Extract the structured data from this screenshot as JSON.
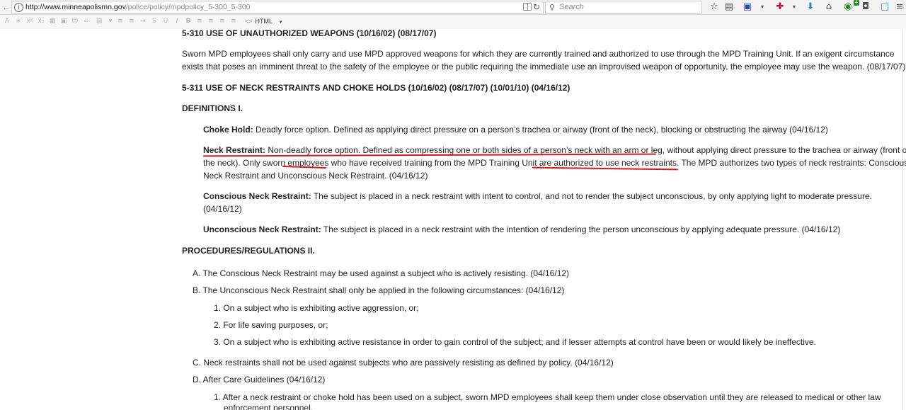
{
  "browser": {
    "url_host": "http://www.minneapolismn.gov",
    "url_path": "/police/policy/mpdpolicy_5-300_5-300",
    "search_placeholder": "Search",
    "badge_count": "4",
    "html_mode": "HTML"
  },
  "doc": {
    "s310_heading": "5-310 USE OF UNAUTHORIZED WEAPONS (10/16/02) (08/17/07)",
    "s310_p1": "Sworn MPD employees shall only carry and use MPD approved weapons for which they are currently trained and authorized to use through the MPD Training Unit. If an exigent circumstance",
    "s310_p2": "exists that poses an imminent threat to the safety of the employee or the public requiring the immediate use an improvised weapon of opportunity, the employee may use the weapon. (08/17/07)",
    "s311_heading": "5-311 USE OF NECK RESTRAINTS AND CHOKE HOLDS (10/16/02) (08/17/07) (10/01/10) (04/16/12)",
    "definitions_heading": "DEFINITIONS I.",
    "choke_term": "Choke Hold:",
    "choke_def": " Deadly force option. Defined as applying direct pressure on a person’s trachea or airway (front of the neck), blocking or obstructing the airway (04/16/12)",
    "neck_term": "Neck Restraint:",
    "neck_l1": " Non-deadly force option. Defined as compressing one or both sides of a person’s neck with an arm or leg, without applying direct pressure to the trachea or airway (front of",
    "neck_l2": "the neck). Only sworn employees who have received training from the MPD Training Unit are authorized to use neck restraints. The MPD authorizes two types of neck restraints: Conscious",
    "neck_l3": "Neck Restraint and Unconscious Neck Restraint. (04/16/12)",
    "conscious_term": "Conscious Neck Restraint:",
    "conscious_l1": " The subject is placed in a neck restraint with intent to control, and not to render the subject unconscious, by only applying light to moderate pressure.",
    "conscious_l2": "(04/16/12)",
    "unconscious_term": "Unconscious Neck Restraint:",
    "unconscious_def": " The subject is placed in a neck restraint with the intention of rendering the person unconscious by applying adequate pressure. (04/16/12)",
    "procedures_heading": "PROCEDURES/REGULATIONS II.",
    "item_a": "A. The Conscious Neck Restraint may be used against a subject who is actively resisting. (04/16/12)",
    "item_b": "B. The Unconscious Neck Restraint shall only be applied in the following circumstances: (04/16/12)",
    "item_b1": "1. On a subject who is exhibiting active aggression, or;",
    "item_b2": "2. For life saving purposes, or;",
    "item_b3": "3. On a subject who is exhibiting active resistance in order to gain control of the subject; and if lesser attempts at control have been or would likely be ineffective.",
    "item_c": "C. Neck restraints shall not be used against subjects who are passively resisting as defined by policy. (04/16/12)",
    "item_d": "D. After Care Guidelines (04/16/12)",
    "item_d1_l1": "1. After a neck restraint or choke hold has been used on a subject, sworn MPD employees shall keep them under close observation until they are released to medical or other law",
    "item_d1_l2": "enforcement personnel."
  },
  "colors": {
    "annotation_ink": "#d41a1a",
    "chrome_bg": "#f3f3f3"
  }
}
